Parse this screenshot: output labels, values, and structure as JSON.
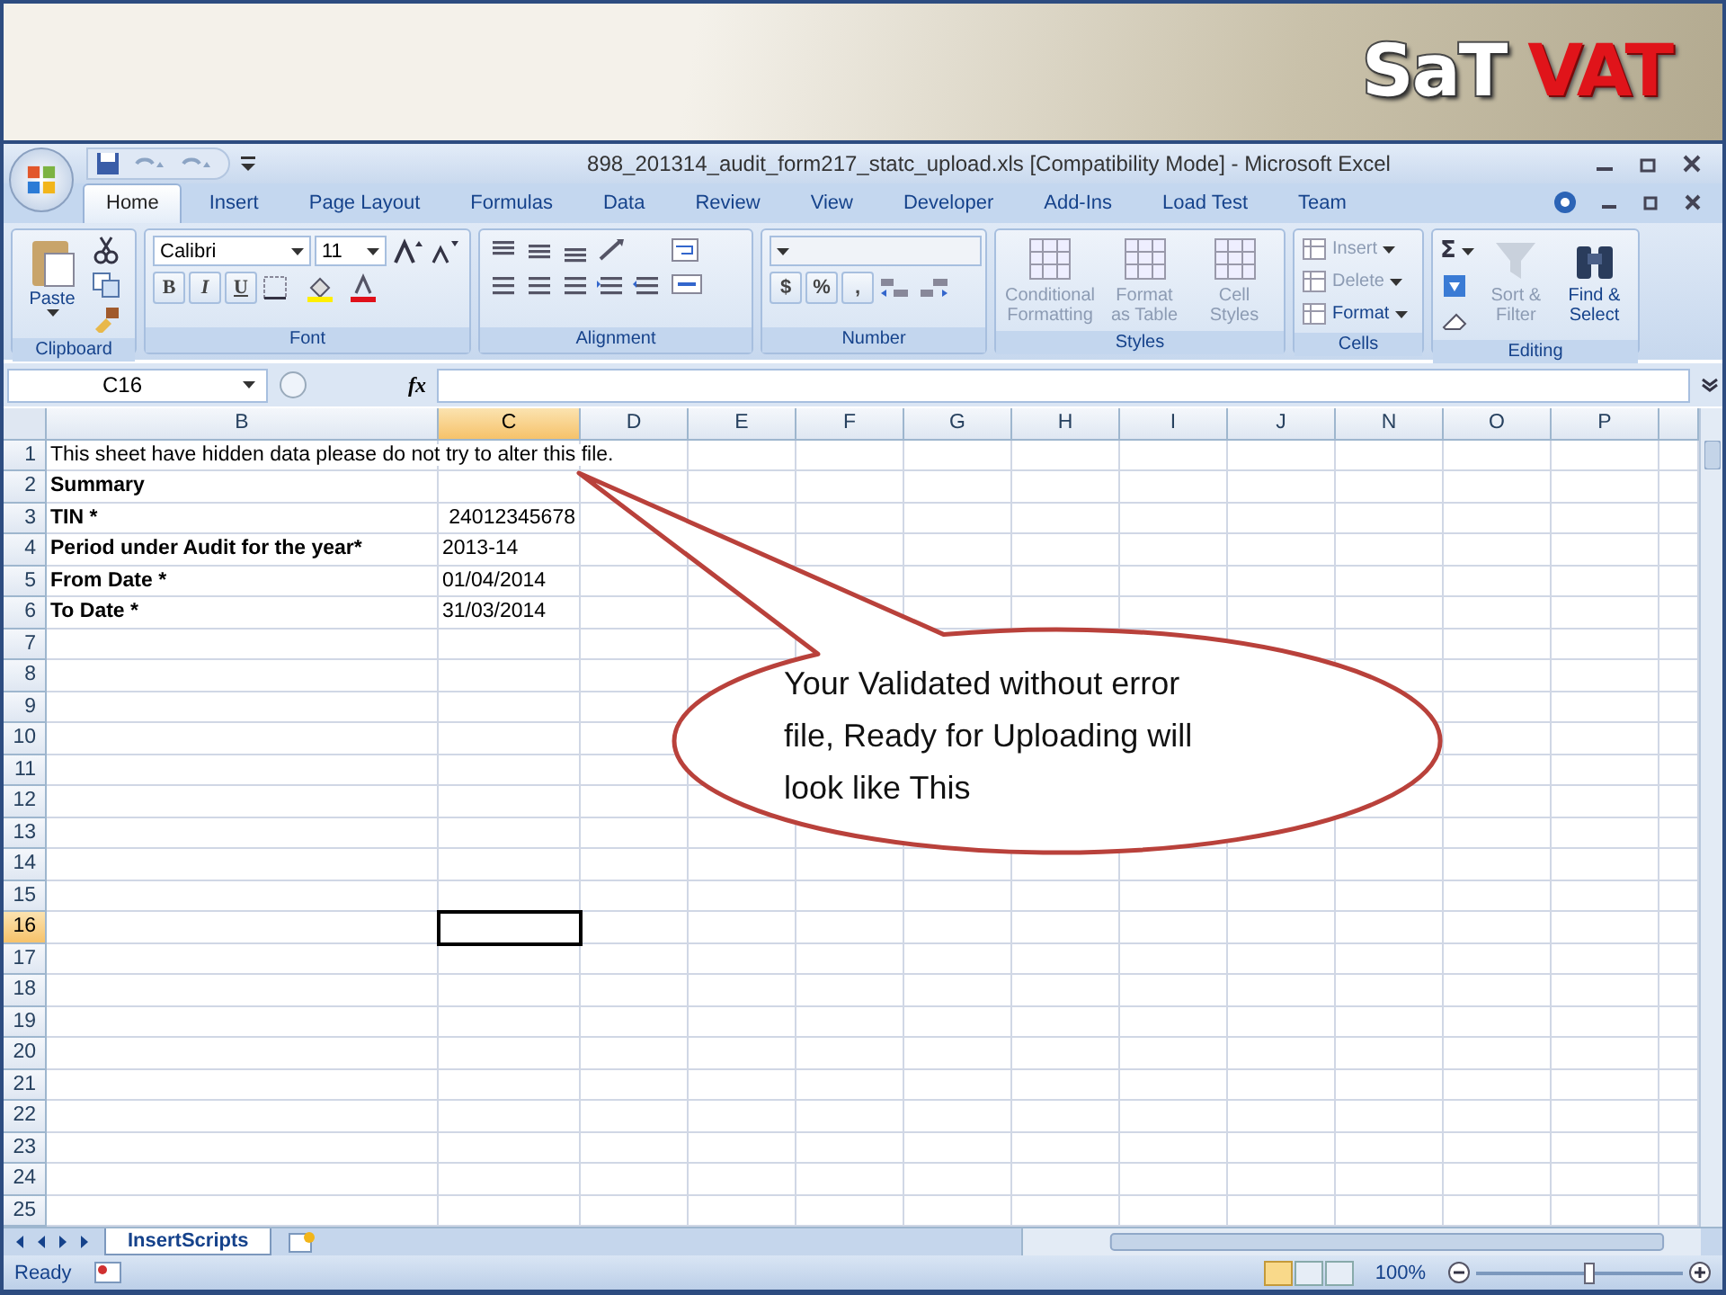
{
  "slide_header": {
    "logo": [
      "SaT",
      "VAT"
    ]
  },
  "window": {
    "title": "898_201314_audit_form217_statc_upload.xls  [Compatibility Mode] - Microsoft Excel"
  },
  "tabs": [
    {
      "label": "Home",
      "selected": true
    },
    {
      "label": "Insert",
      "selected": false
    },
    {
      "label": "Page Layout",
      "selected": false
    },
    {
      "label": "Formulas",
      "selected": false
    },
    {
      "label": "Data",
      "selected": false
    },
    {
      "label": "Review",
      "selected": false
    },
    {
      "label": "View",
      "selected": false
    },
    {
      "label": "Developer",
      "selected": false
    },
    {
      "label": "Add-Ins",
      "selected": false
    },
    {
      "label": "Load Test",
      "selected": false
    },
    {
      "label": "Team",
      "selected": false
    }
  ],
  "ribbon_groups": [
    {
      "label": "Clipboard",
      "kind": "clipboard",
      "buttons": [
        {
          "label": "Paste",
          "disabled": false
        }
      ]
    },
    {
      "label": "Font",
      "kind": "font",
      "font_name": "Calibri",
      "font_size": "11",
      "style_buttons": [
        "B",
        "I",
        "U"
      ]
    },
    {
      "label": "Alignment",
      "kind": "alignment"
    },
    {
      "label": "Number",
      "kind": "number",
      "symbols": [
        "$",
        "%",
        ","
      ]
    },
    {
      "label": "Styles",
      "kind": "styles",
      "buttons": [
        {
          "label": "Conditional Formatting",
          "disabled": true
        },
        {
          "label": "Format as Table",
          "disabled": true
        },
        {
          "label": "Cell Styles",
          "disabled": true
        }
      ]
    },
    {
      "label": "Cells",
      "kind": "cells",
      "buttons": [
        {
          "label": "Insert",
          "disabled": true
        },
        {
          "label": "Delete",
          "disabled": true
        },
        {
          "label": "Format",
          "disabled": false
        }
      ]
    },
    {
      "label": "Editing",
      "kind": "editing",
      "autosum_symbol": "Σ",
      "buttons": [
        {
          "label": "Sort & Filter",
          "disabled": true
        },
        {
          "label": "Find & Select",
          "disabled": false
        }
      ]
    }
  ],
  "formula_bar": {
    "name_box": "C16",
    "function_label": "fx"
  },
  "sheet": {
    "columns": [
      {
        "label": "B",
        "selected": false
      },
      {
        "label": "C",
        "selected": true
      },
      {
        "label": "D",
        "selected": false
      },
      {
        "label": "E",
        "selected": false
      },
      {
        "label": "F",
        "selected": false
      },
      {
        "label": "G",
        "selected": false
      },
      {
        "label": "H",
        "selected": false
      },
      {
        "label": "I",
        "selected": false
      },
      {
        "label": "J",
        "selected": false
      },
      {
        "label": "N",
        "selected": false
      },
      {
        "label": "O",
        "selected": false
      },
      {
        "label": "P",
        "selected": false
      }
    ],
    "rows": [
      {
        "number": "1",
        "selected": false,
        "cells": [
          {
            "text": "This sheet have hidden data please do not try to alter this file.",
            "kind": "text",
            "bold": false,
            "selected": false
          }
        ]
      },
      {
        "number": "2",
        "selected": false,
        "cells": [
          {
            "text": "Summary",
            "kind": "text",
            "bold": true,
            "selected": false
          }
        ]
      },
      {
        "number": "3",
        "selected": false,
        "cells": [
          {
            "text": "TIN *",
            "kind": "text",
            "bold": true,
            "selected": false
          },
          {
            "text": "24012345678",
            "kind": "number",
            "bold": false,
            "selected": false
          }
        ]
      },
      {
        "number": "4",
        "selected": false,
        "cells": [
          {
            "text": "Period under Audit for the year*",
            "kind": "text",
            "bold": true,
            "selected": false
          },
          {
            "text": "2013-14",
            "kind": "text",
            "bold": false,
            "selected": false
          }
        ]
      },
      {
        "number": "5",
        "selected": false,
        "cells": [
          {
            "text": "From Date *",
            "kind": "text",
            "bold": true,
            "selected": false
          },
          {
            "text": "01/04/2014",
            "kind": "text",
            "bold": false,
            "selected": false
          }
        ]
      },
      {
        "number": "6",
        "selected": false,
        "cells": [
          {
            "text": "To Date *",
            "kind": "text",
            "bold": true,
            "selected": false
          },
          {
            "text": "31/03/2014",
            "kind": "text",
            "bold": false,
            "selected": false
          }
        ]
      },
      {
        "number": "7",
        "selected": false
      },
      {
        "number": "8",
        "selected": false
      },
      {
        "number": "9",
        "selected": false
      },
      {
        "number": "10",
        "selected": false
      },
      {
        "number": "11",
        "selected": false
      },
      {
        "number": "12",
        "selected": false
      },
      {
        "number": "13",
        "selected": false
      },
      {
        "number": "14",
        "selected": false
      },
      {
        "number": "15",
        "selected": false
      },
      {
        "number": "16",
        "selected": true,
        "cells": [
          {
            "kind": "empty",
            "selected": false
          },
          {
            "kind": "empty",
            "selected": true
          }
        ]
      },
      {
        "number": "17",
        "selected": false
      },
      {
        "number": "18",
        "selected": false
      },
      {
        "number": "19",
        "selected": false
      },
      {
        "number": "20",
        "selected": false
      },
      {
        "number": "21",
        "selected": false
      },
      {
        "number": "22",
        "selected": false
      },
      {
        "number": "23",
        "selected": false
      },
      {
        "number": "24",
        "selected": false
      },
      {
        "number": "25",
        "selected": false
      }
    ]
  },
  "sheet_tabs": [
    {
      "label": "InsertScripts",
      "selected": true
    }
  ],
  "status_bar": {
    "status": "Ready",
    "views": [
      {
        "selected": true
      },
      {
        "selected": false
      },
      {
        "selected": false
      }
    ],
    "zoom": "100%",
    "zoom_slider": {
      "level": 0.55
    }
  },
  "callout": {
    "text": "Your Validated without error file, Ready for Uploading will look like This"
  }
}
